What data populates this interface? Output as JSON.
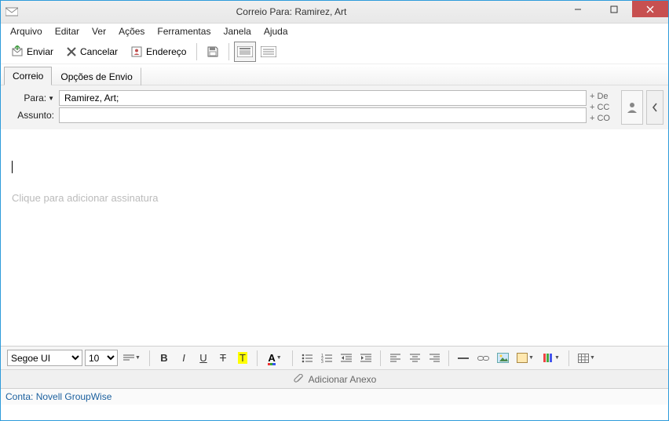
{
  "window": {
    "title": "Correio Para: Ramirez, Art"
  },
  "menu": {
    "file": "Arquivo",
    "edit": "Editar",
    "view": "Ver",
    "actions": "Ações",
    "tools": "Ferramentas",
    "window": "Janela",
    "help": "Ajuda"
  },
  "toolbar": {
    "send": "Enviar",
    "cancel": "Cancelar",
    "address": "Endereço"
  },
  "tabs": {
    "mail": "Correio",
    "sendoptions": "Opções de Envio"
  },
  "fields": {
    "to_label": "Para:",
    "to_value": "Ramirez, Art;",
    "subject_label": "Assunto:",
    "subject_value": "",
    "add_de": "De",
    "add_cc": "CC",
    "add_co": "CO"
  },
  "body": {
    "signature_hint": "Clique para adicionar assinatura"
  },
  "format": {
    "font_name": "Segoe UI",
    "font_size": "10"
  },
  "attach": {
    "label": "Adicionar Anexo"
  },
  "status": {
    "account_label": "Conta:",
    "account_value": "Novell GroupWise"
  }
}
